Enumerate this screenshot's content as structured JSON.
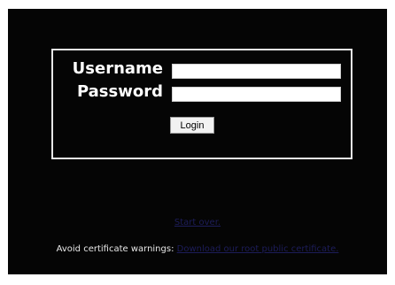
{
  "login": {
    "username_label": "Username",
    "password_label": "Password",
    "username_value": "",
    "password_value": "",
    "login_button_label": "Login"
  },
  "links": {
    "start_over": "Start over.",
    "cert_prefix": "Avoid certificate warnings: ",
    "cert_link": "Download our root public certificate."
  },
  "colors": {
    "background": "#050505",
    "border": "#e8e8e8",
    "label_text": "#ffffff",
    "link_text": "#1d1d5a",
    "page_frame": "#ffffff"
  }
}
